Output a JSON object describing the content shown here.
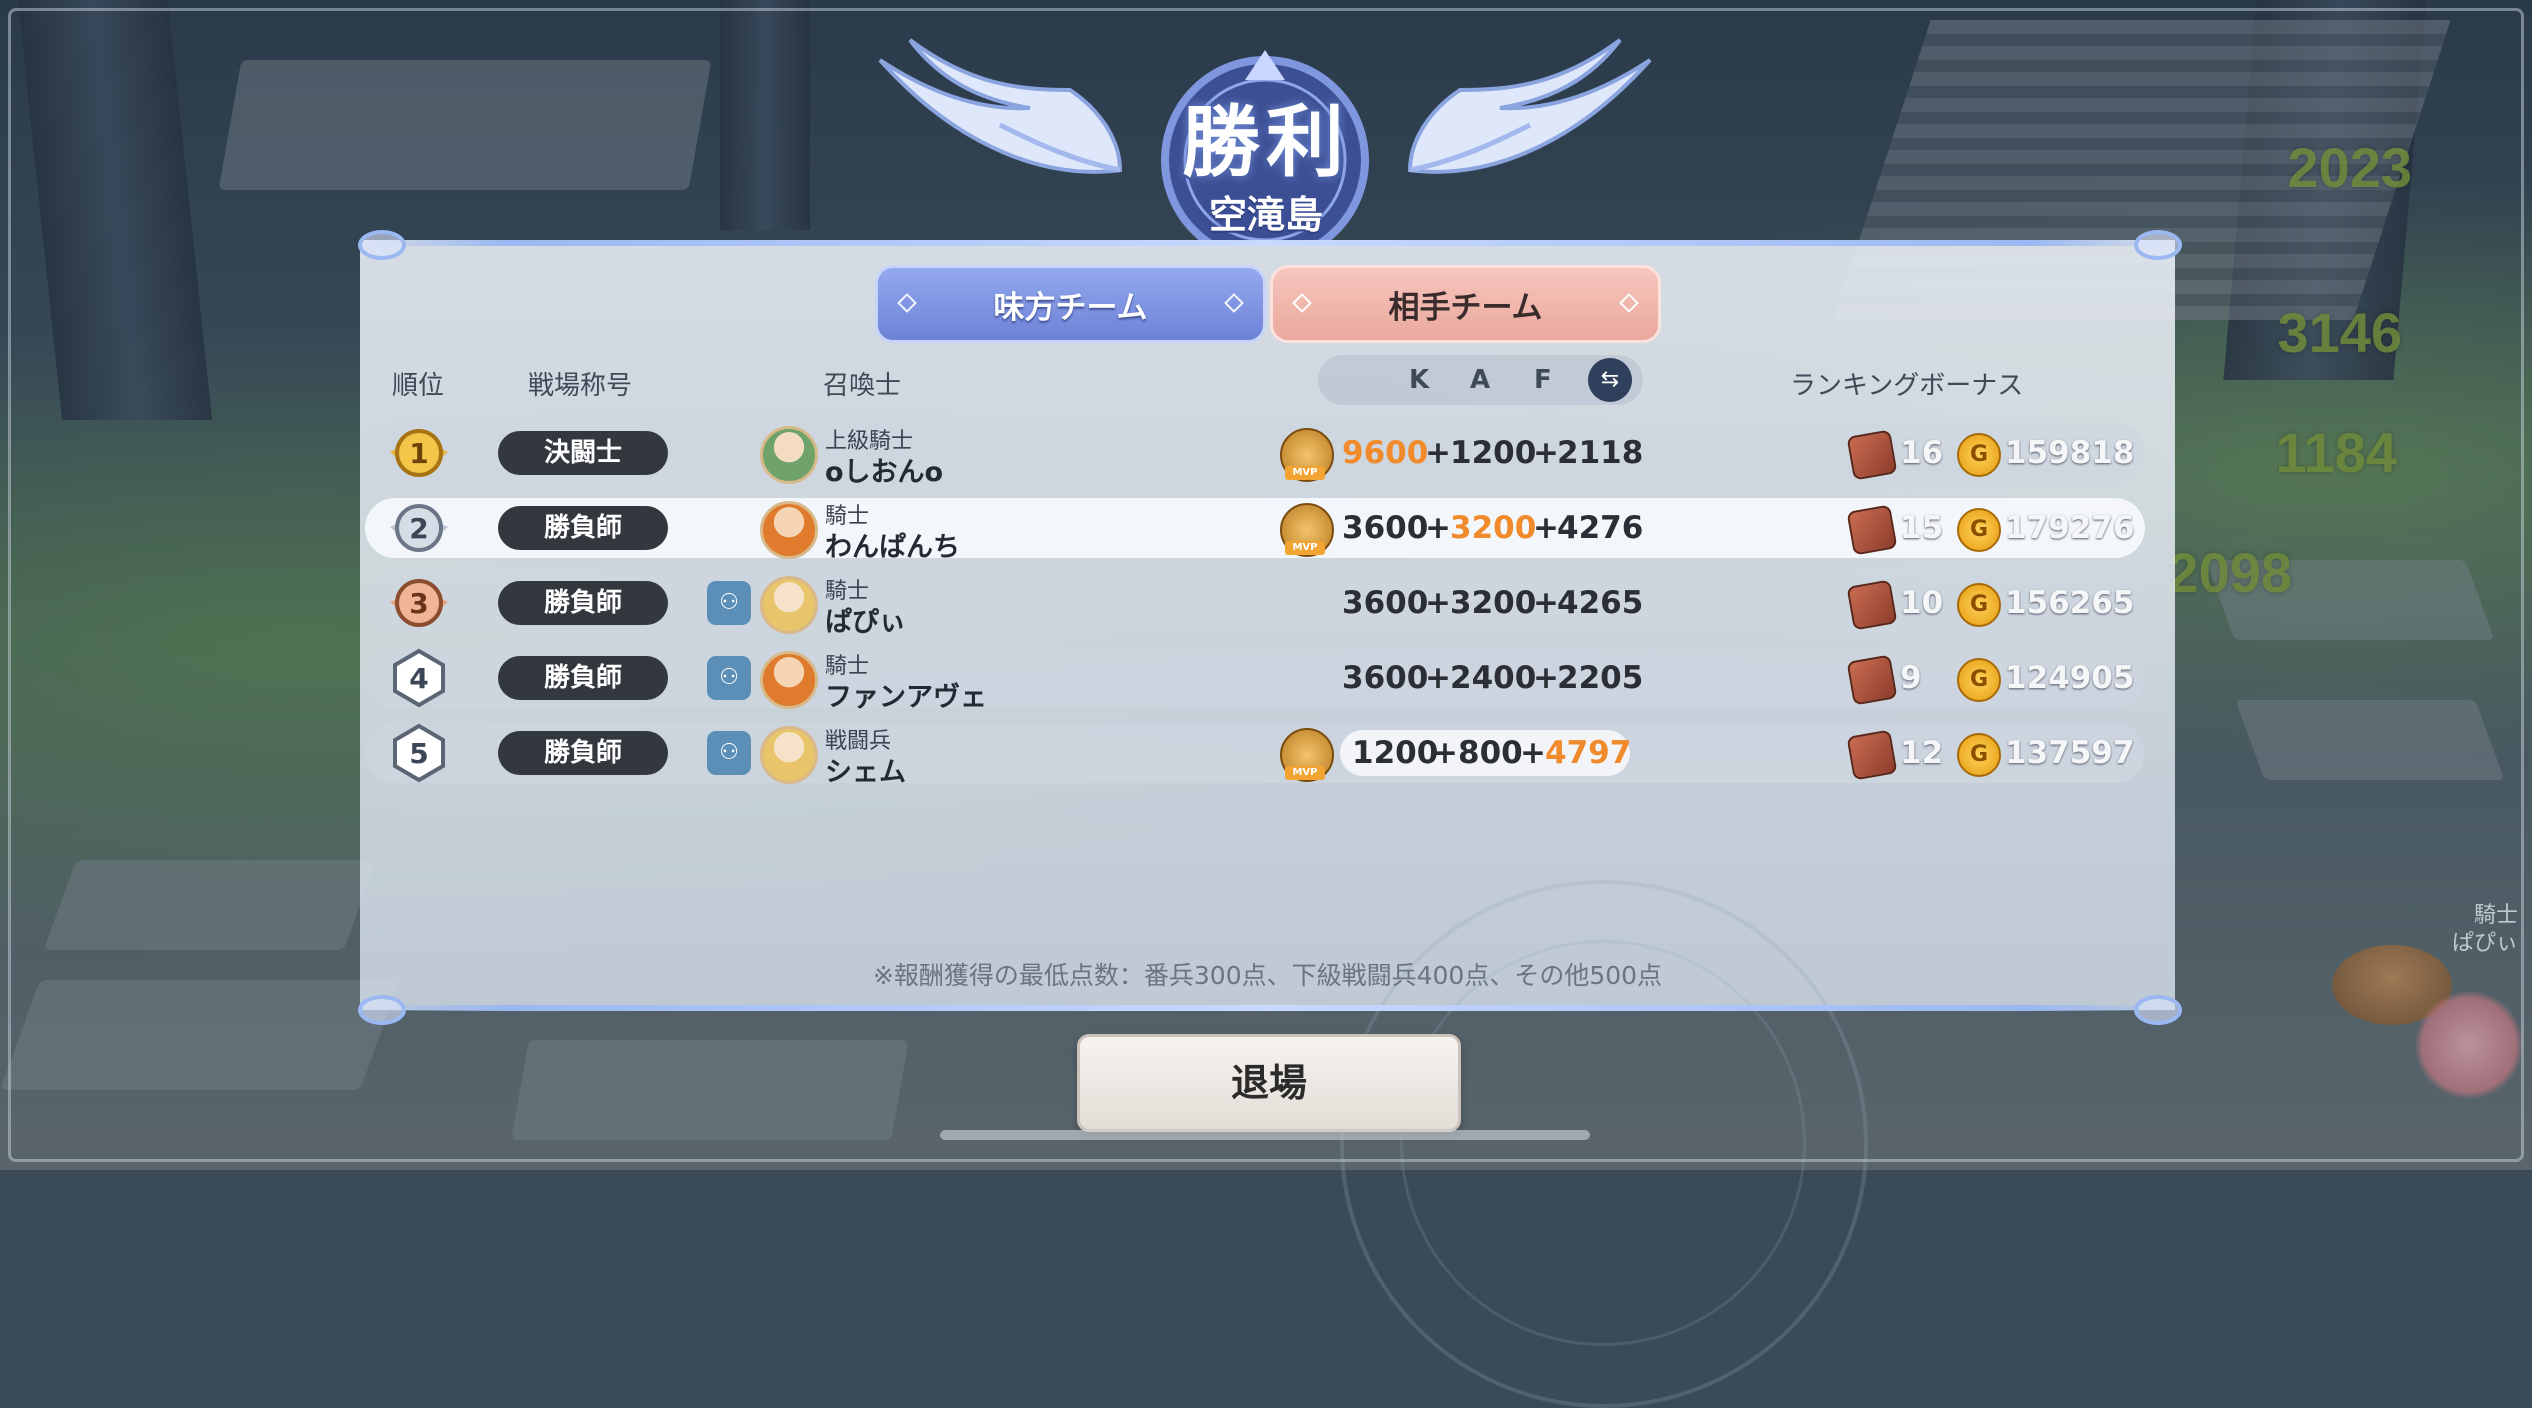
{
  "header": {
    "result": "勝利",
    "map_name": "空滝島"
  },
  "tabs": {
    "ally": "味方チーム",
    "enemy": "相手チーム",
    "active": "enemy"
  },
  "columns": {
    "rank": "順位",
    "title": "戦場称号",
    "summoner": "召喚士",
    "k": "K",
    "a": "A",
    "f": "F",
    "bonus": "ランキングボーナス"
  },
  "rows": [
    {
      "rank": "1",
      "badge": "gold",
      "title": "決闘士",
      "party": false,
      "class": "上級騎士",
      "name": "oしおんo",
      "mvp": "MVP",
      "k": "9600",
      "a": "1200",
      "f": "2118",
      "highlight_k": true,
      "highlight_a": false,
      "highlight_f": false,
      "chests": "16",
      "gold": "159818"
    },
    {
      "rank": "2",
      "badge": "silver",
      "title": "勝負師",
      "party": false,
      "class": "騎士",
      "name": "わんぱんち",
      "mvp": "MVP",
      "k": "3600",
      "a": "3200",
      "f": "4276",
      "highlight_k": false,
      "highlight_a": true,
      "highlight_f": false,
      "chests": "15",
      "gold": "179276"
    },
    {
      "rank": "3",
      "badge": "bronze",
      "title": "勝負師",
      "party": true,
      "class": "騎士",
      "name": "ぱぴぃ",
      "mvp": "",
      "k": "3600",
      "a": "3200",
      "f": "4265",
      "highlight_k": false,
      "highlight_a": false,
      "highlight_f": false,
      "chests": "10",
      "gold": "156265"
    },
    {
      "rank": "4",
      "badge": "plain",
      "title": "勝負師",
      "party": true,
      "class": "騎士",
      "name": "ファンアヴェ",
      "mvp": "",
      "k": "3600",
      "a": "2400",
      "f": "2205",
      "highlight_k": false,
      "highlight_a": false,
      "highlight_f": false,
      "chests": "9",
      "gold": "124905"
    },
    {
      "rank": "5",
      "badge": "plain",
      "title": "勝負師",
      "party": true,
      "class": "戦闘兵",
      "name": "シェム",
      "mvp": "MVP",
      "k": "1200",
      "a": "800",
      "f": "4797",
      "highlight_k": false,
      "highlight_a": false,
      "highlight_f": true,
      "chests": "12",
      "gold": "137597"
    }
  ],
  "note": "※報酬獲得の最低点数：番兵300点、下級戦闘兵400点、その他500点",
  "exit_button": "退場",
  "background": {
    "scores": [
      "2023",
      "3146",
      "1184",
      "2098"
    ],
    "corner_class": "騎士",
    "corner_name": "ぱぴぃ"
  },
  "colors": {
    "highlight_value": "#f08a2a",
    "ally_tab": "#7f93df",
    "enemy_tab": "#eeb3a8",
    "title_pill": "#33383f"
  }
}
